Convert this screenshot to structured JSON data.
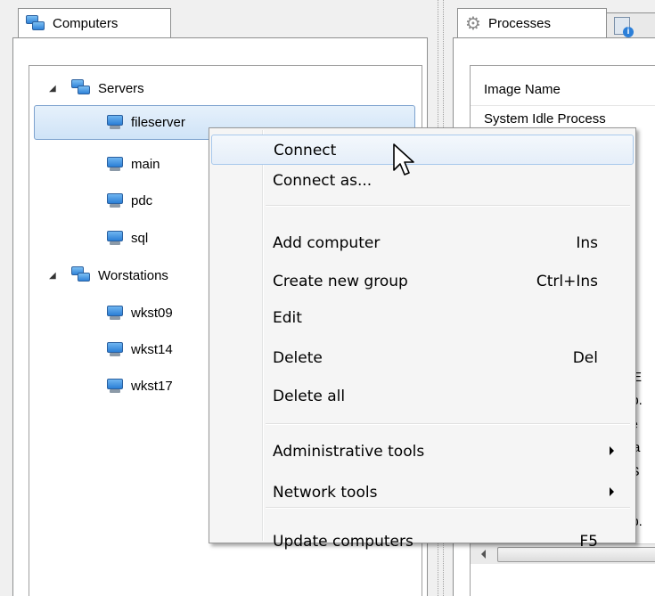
{
  "left_tab": {
    "label": "Computers",
    "icon": "computers-group-icon"
  },
  "right_tabs": [
    {
      "label": "Processes",
      "icon": "gear-icon"
    },
    {
      "label": "",
      "icon": "info-document-icon"
    }
  ],
  "tree": {
    "groups": [
      {
        "label": "Servers",
        "children": [
          "fileserver",
          "main",
          "pdc",
          "sql"
        ]
      },
      {
        "label": "Worstations",
        "children": [
          "wkst09",
          "wkst14",
          "wkst17"
        ]
      }
    ],
    "selected": "fileserver"
  },
  "process_list": {
    "column_header": "Image Name",
    "partial_rows": [
      "System Idle Process",
      "e",
      "SE",
      "pp.",
      "xe",
      "Ba",
      "xS",
      "pp."
    ]
  },
  "context_menu": {
    "items": [
      {
        "label": "Connect",
        "shortcut": "",
        "submenu": false,
        "highlighted": true
      },
      {
        "label": "Connect as...",
        "shortcut": "",
        "submenu": false
      },
      {
        "label": "Add computer",
        "shortcut": "Ins",
        "submenu": false
      },
      {
        "label": "Create new group",
        "shortcut": "Ctrl+Ins",
        "submenu": false
      },
      {
        "label": "Edit",
        "shortcut": "",
        "submenu": false
      },
      {
        "label": "Delete",
        "shortcut": "Del",
        "submenu": false
      },
      {
        "label": "Delete all",
        "shortcut": "",
        "submenu": false
      },
      {
        "label": "Administrative tools",
        "shortcut": "",
        "submenu": true
      },
      {
        "label": "Network tools",
        "shortcut": "",
        "submenu": true
      },
      {
        "label": "Update computers",
        "shortcut": "F5",
        "submenu": false
      }
    ]
  },
  "colors": {
    "selection": "#cfe3f7",
    "menu_background": "#f5f5f5",
    "menu_highlight": "#e5eef9"
  }
}
